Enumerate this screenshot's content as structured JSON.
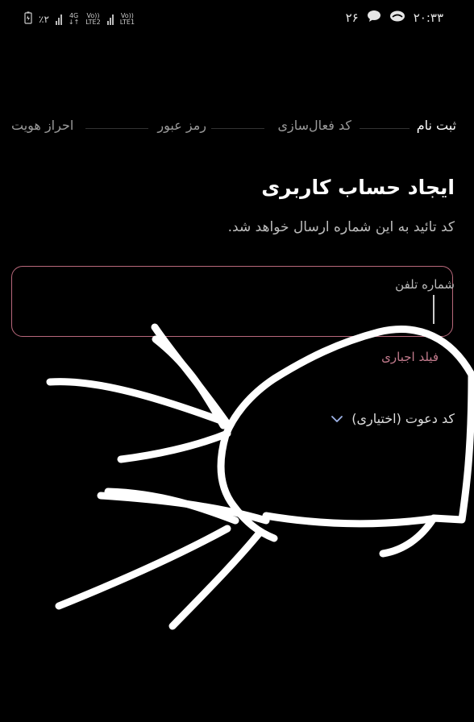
{
  "status_bar": {
    "battery_percent": "٪۲",
    "network_4g": "4G",
    "volte_1": "Vo))",
    "lte_2": "LTE2",
    "volte_2": "Vo))",
    "lte_1": "LTE1",
    "time": "۲۰:۳۳",
    "notification_count": "۲۶"
  },
  "steps": [
    {
      "label": "ثبت نام",
      "active": true
    },
    {
      "label": "کد فعال‌سازی",
      "active": false
    },
    {
      "label": "رمز عبور",
      "active": false
    },
    {
      "label": "احراز هویت",
      "active": false
    }
  ],
  "page": {
    "title": "ایجاد حساب کاربری",
    "subtitle": "کد تائید به این شماره ارسال خواهد شد."
  },
  "phone_field": {
    "label": "شماره تلفن",
    "value": "",
    "helper": "فیلد اجباری"
  },
  "invite": {
    "label": "کد دعوت (اختیاری)"
  },
  "colors": {
    "background": "#000000",
    "field_border": "#b8687b",
    "error": "#c37b8d",
    "step_inactive": "#9a9a9a"
  }
}
